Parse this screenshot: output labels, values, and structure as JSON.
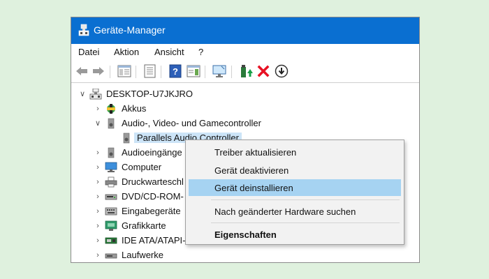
{
  "window": {
    "title": "Geräte-Manager"
  },
  "menubar": {
    "items": [
      "Datei",
      "Aktion",
      "Ansicht",
      "?"
    ]
  },
  "toolbar": {
    "icons": [
      "back-arrow-icon",
      "forward-arrow-icon",
      "show-hide-console-tree-icon",
      "properties-icon",
      "help-icon",
      "action-pane-icon",
      "monitor-scan-icon",
      "update-driver-icon",
      "uninstall-device-icon",
      "download-icon"
    ],
    "uninstall_color": "#e81123"
  },
  "tree": {
    "root": "DESKTOP-U7JKJRO",
    "items": [
      {
        "label": "Akkus",
        "icon": "battery-icon",
        "expanded": false
      },
      {
        "label": "Audio-, Video- und Gamecontroller",
        "icon": "speaker-icon",
        "expanded": true
      },
      {
        "label": "Parallels Audio Controller",
        "icon": "speaker-icon",
        "selected": true
      },
      {
        "label": "Audioeingänge",
        "icon": "speaker-icon",
        "expanded": false
      },
      {
        "label": "Computer",
        "icon": "computer-icon",
        "expanded": false
      },
      {
        "label": "Druckwarteschl",
        "icon": "printer-icon",
        "expanded": false
      },
      {
        "label": "DVD/CD-ROM-",
        "icon": "dvd-drive-icon",
        "expanded": false
      },
      {
        "label": "Eingabegeräte",
        "icon": "keyboard-icon",
        "expanded": false
      },
      {
        "label": "Grafikkarte",
        "icon": "display-adapter-icon",
        "expanded": false
      },
      {
        "label": "IDE ATA/ATAPI-C",
        "icon": "ide-controller-icon",
        "expanded": false
      },
      {
        "label": "Laufwerke",
        "icon": "disk-drive-icon",
        "expanded": false
      }
    ]
  },
  "context_menu": {
    "items": [
      "Treiber aktualisieren",
      "Gerät deaktivieren",
      "Gerät deinstallieren",
      "Nach geänderter Hardware suchen",
      "Eigenschaften"
    ],
    "highlighted": "Gerät deinstallieren",
    "highlight_color": "#a6d3f2"
  },
  "colors": {
    "titlebar": "#0a6fd1",
    "background": "#dff1de"
  }
}
